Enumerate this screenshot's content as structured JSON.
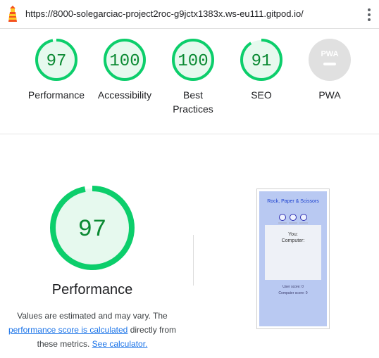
{
  "browser": {
    "url": "https://8000-solegarciac-project2roc-g9jctx1383x.ws-eu111.gitpod.io/",
    "logo_icon": "lighthouse-icon",
    "menu_icon": "kebab-menu-icon"
  },
  "colors": {
    "pass": "#0cce6b",
    "pass_fill": "#e6f9ee",
    "pass_text": "#0b8a33",
    "na": "#e0e0e0",
    "link": "#1a73e8"
  },
  "categories": [
    {
      "score": "97",
      "label": "Performance"
    },
    {
      "score": "100",
      "label": "Accessibility"
    },
    {
      "score": "100",
      "label": "Best Practices",
      "line1": "Best",
      "line2": "Practices"
    },
    {
      "score": "91",
      "label": "SEO"
    },
    {
      "label": "PWA",
      "badge": "PWA"
    }
  ],
  "performance": {
    "score": "97",
    "title": "Performance",
    "note_text1": "Values are estimated and may vary. The",
    "link1": "performance score is calculated",
    "note_text2": "directly from",
    "note_text3": "these metrics.",
    "link2": "See calculator."
  },
  "thumbnail": {
    "title": "Rock, Paper & Scissors",
    "you": "You:",
    "computer": "Computer:",
    "user_score": "User score: 0",
    "computer_score": "Computer score: 0"
  }
}
